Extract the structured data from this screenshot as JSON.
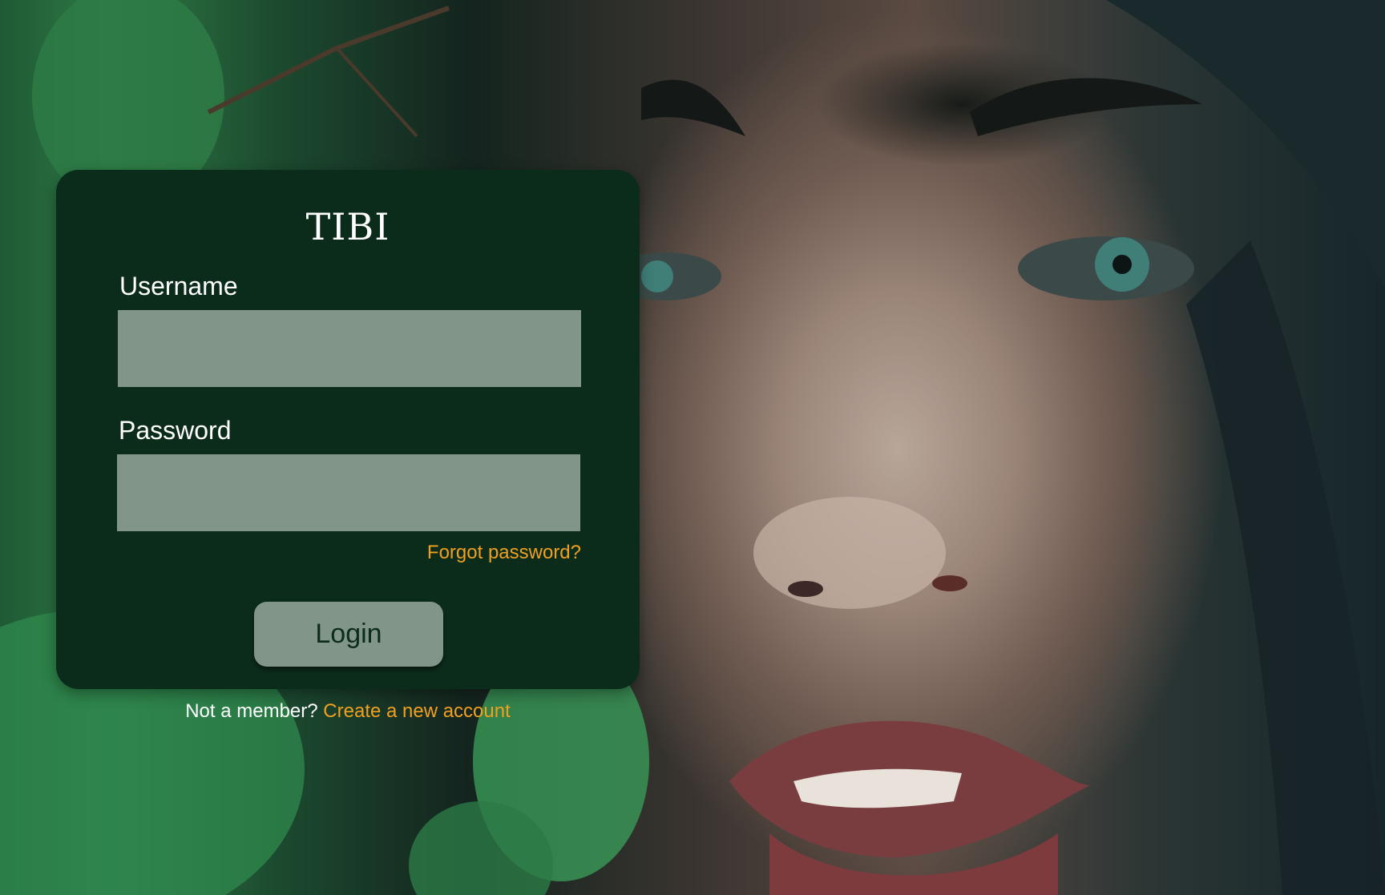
{
  "brand": {
    "name": "TIBI"
  },
  "form": {
    "username_label": "Username",
    "username_value": "",
    "password_label": "Password",
    "password_value": "",
    "forgot_password": "Forgot password?",
    "login_label": "Login"
  },
  "signup": {
    "prompt": "Not a member?",
    "link": "Create a new account"
  },
  "colors": {
    "card_background": "#0c2c1b",
    "input_background": "#819588",
    "link_accent": "#f0a020",
    "text_light": "#ffffff"
  }
}
